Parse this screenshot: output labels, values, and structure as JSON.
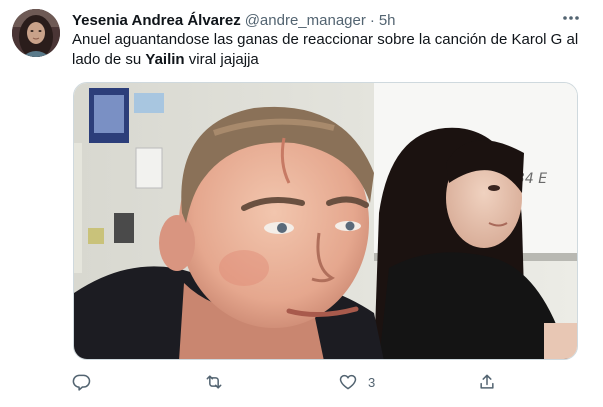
{
  "tweet": {
    "display_name": "Yesenia Andrea Álvarez",
    "handle": "@andre_manager",
    "separator": "·",
    "time": "5h",
    "text_before": "Anuel aguantandose las ganas de reaccionar sobre la canción de Karol G al lado de su ",
    "text_bold": "Yailin",
    "text_after": " viral jajajja",
    "media": {
      "kind": "meme photo",
      "whiteboard_text": "4-34 E"
    },
    "actions": {
      "reply_icon": "reply-icon",
      "retweet_icon": "retweet-icon",
      "like_icon": "heart-icon",
      "like_count": "3",
      "share_icon": "share-icon"
    },
    "more_icon": "more-dots-icon"
  },
  "colors": {
    "text": "#0f1419",
    "secondary": "#536471",
    "border": "#cfd9de"
  }
}
